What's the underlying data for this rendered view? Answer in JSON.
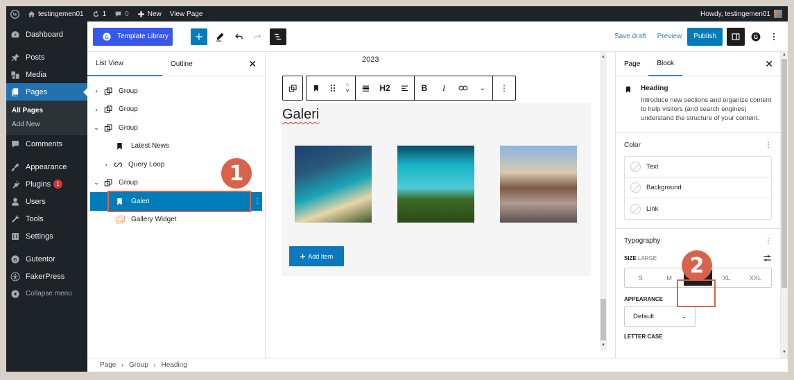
{
  "admin_bar": {
    "site_name": "testingemen01",
    "updates_count": "1",
    "comments_count": "0",
    "new_label": "New",
    "view_page_label": "View Page",
    "howdy": "Howdy, testingemen01"
  },
  "sidebar": {
    "items": [
      {
        "label": "Dashboard",
        "icon": "dashboard-icon"
      },
      {
        "label": "Posts",
        "icon": "pin-icon"
      },
      {
        "label": "Media",
        "icon": "media-icon"
      },
      {
        "label": "Pages",
        "icon": "pages-icon",
        "active": true
      },
      {
        "label": "Comments",
        "icon": "comment-icon"
      },
      {
        "label": "Appearance",
        "icon": "brush-icon"
      },
      {
        "label": "Plugins",
        "icon": "plugin-icon",
        "badge": "1"
      },
      {
        "label": "Users",
        "icon": "user-icon"
      },
      {
        "label": "Tools",
        "icon": "wrench-icon"
      },
      {
        "label": "Settings",
        "icon": "settings-icon"
      },
      {
        "label": "Gutentor",
        "icon": "gutentor-icon"
      },
      {
        "label": "FakerPress",
        "icon": "accessibility-icon"
      }
    ],
    "submenu": [
      "All Pages",
      "Add New"
    ],
    "collapse_label": "Collapse menu"
  },
  "toolbar": {
    "template_library_label": "Template Library",
    "save_draft_label": "Save draft",
    "preview_label": "Preview",
    "publish_label": "Publish"
  },
  "list_view": {
    "tabs": [
      "List View",
      "Outline"
    ],
    "rows": [
      {
        "label": "Group",
        "icon": "group-icon",
        "chevron": "right",
        "depth": 0
      },
      {
        "label": "Group",
        "icon": "group-icon",
        "chevron": "right",
        "depth": 0
      },
      {
        "label": "Group",
        "icon": "group-icon",
        "chevron": "down",
        "depth": 0
      },
      {
        "label": "Latest News",
        "icon": "bookmark-icon",
        "chevron": "",
        "depth": 1
      },
      {
        "label": "Query Loop",
        "icon": "loop-icon",
        "chevron": "right",
        "depth": 1
      },
      {
        "label": "Group",
        "icon": "group-icon",
        "chevron": "down",
        "depth": 0
      },
      {
        "label": "Galeri",
        "icon": "bookmark-icon",
        "chevron": "",
        "depth": 1,
        "selected": true
      },
      {
        "label": "Gallery Widget",
        "icon": "gallery-icon",
        "chevron": "",
        "depth": 1
      }
    ]
  },
  "canvas": {
    "year_text": "2023",
    "block_toolbar": {
      "heading_level": "H2"
    },
    "heading_text": "Galeri",
    "gallery_images": [
      "Cliff beach aerial",
      "Turquoise sea and forest aerial",
      "Volcano at sunrise"
    ],
    "add_item_label": "Add Item"
  },
  "inspector": {
    "tabs": [
      "Page",
      "Block"
    ],
    "block_title": "Heading",
    "block_description": "Introduce new sections and organize content to help visitors (and search engines) understand the structure of your content.",
    "color_panel": {
      "title": "Color",
      "items": [
        "Text",
        "Background",
        "Link"
      ]
    },
    "typography_panel": {
      "title": "Typography",
      "size_label": "SIZE",
      "size_value": "LARGE",
      "size_options": [
        "S",
        "M",
        "L",
        "XL",
        "XXL"
      ],
      "selected_size": "L",
      "appearance_label": "APPEARANCE",
      "appearance_value": "Default",
      "letter_case_label": "LETTER CASE"
    }
  },
  "breadcrumb": [
    "Page",
    "Group",
    "Heading"
  ],
  "annotations": [
    "1",
    "2"
  ],
  "colors": {
    "wp_blue": "#007cba",
    "template_blue": "#3858e9",
    "annotation": "#d9624a",
    "admin_dark": "#1d2327"
  }
}
